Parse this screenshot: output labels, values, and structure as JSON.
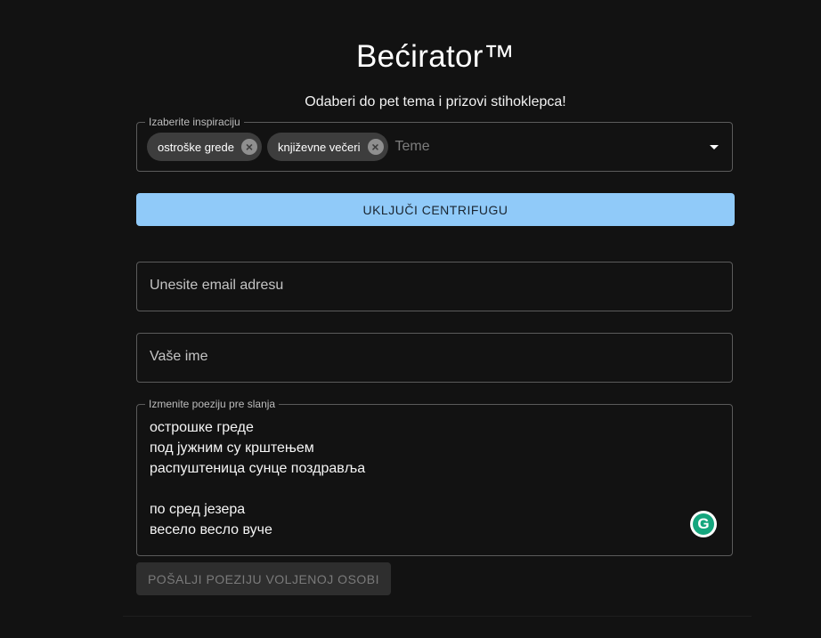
{
  "header": {
    "title": "Bećirator™",
    "subtitle": "Odaberi do pet tema i prizovi stihoklepca!"
  },
  "theme_select": {
    "label": "Izaberite inspiraciju",
    "chips": [
      {
        "label": "ostroške grede"
      },
      {
        "label": "književne večeri"
      }
    ],
    "chip_delete_icon": "cancel-icon",
    "placeholder": "Teme",
    "arrow_icon": "arrow-drop-down-icon"
  },
  "actions": {
    "centrifuge_label": "UKLJUČI CENTRIFUGU",
    "send_label": "POŠALJI POEZIJU VOLJENOJ OSOBI",
    "send_disabled": true
  },
  "email": {
    "placeholder": "Unesite email adresu"
  },
  "name": {
    "placeholder": "Vaše ime"
  },
  "poem": {
    "label": "Izmenite poeziju pre slanja",
    "lines": [
      "острошке греде",
      "под јужним су крштењем",
      "распуштеница сунце поздравља",
      "",
      "по сред језера",
      "весело весло вуче"
    ]
  },
  "icons": {
    "grammarly": "grammarly-icon"
  },
  "colors": {
    "background": "#121212",
    "primary_button": "#90caf9",
    "disabled_button": "#2e2e2e",
    "grammarly_green": "#15a67e"
  }
}
